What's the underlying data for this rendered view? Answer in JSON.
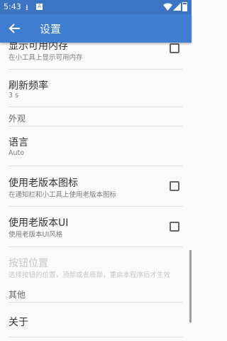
{
  "status_bar": {
    "time": "5:43",
    "download_icon": "download-icon",
    "app_icon": "app-notification-icon"
  },
  "toolbar": {
    "back_icon": "arrow-left-icon",
    "title": "设置"
  },
  "settings": {
    "show_memory": {
      "title": "显示可用内存",
      "summary": "在小工具上显示可用内存",
      "checked": false
    },
    "refresh_rate": {
      "title": "刷新频率",
      "summary": "3 s"
    },
    "appearance_header": "外观",
    "language": {
      "title": "语言",
      "summary": "Auto"
    },
    "old_icon": {
      "title": "使用老版本图标",
      "summary": "在通知栏和小工具上使用老版本图标",
      "checked": false
    },
    "old_ui": {
      "title": "使用老版本UI",
      "summary": "使用老版本UI风格",
      "checked": false
    },
    "button_position": {
      "title": "按钮位置",
      "summary": "选择按钮的位置，顶部或者底部，重启本程序后才生效",
      "enabled": false
    },
    "other_header": "其他",
    "about": {
      "title": "关于"
    }
  },
  "colors": {
    "status_bar": "#3b74c2",
    "toolbar": "#3e7dd0",
    "background": "#fafafa"
  }
}
